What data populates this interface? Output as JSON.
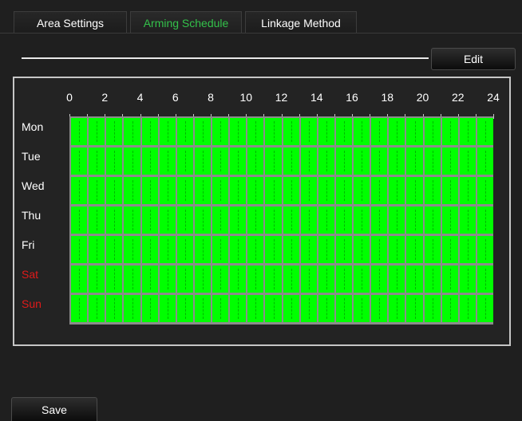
{
  "tabs": [
    {
      "label": "Area Settings",
      "active": false
    },
    {
      "label": "Arming Schedule",
      "active": true
    },
    {
      "label": "Linkage Method",
      "active": false
    }
  ],
  "toolbar": {
    "edit_label": "Edit"
  },
  "schedule": {
    "hours": [
      "0",
      "2",
      "4",
      "6",
      "8",
      "10",
      "12",
      "14",
      "16",
      "18",
      "20",
      "22",
      "24"
    ],
    "days": [
      {
        "label": "Mon",
        "weekend": false,
        "armed_all_day": true
      },
      {
        "label": "Tue",
        "weekend": false,
        "armed_all_day": true
      },
      {
        "label": "Wed",
        "weekend": false,
        "armed_all_day": true
      },
      {
        "label": "Thu",
        "weekend": false,
        "armed_all_day": true
      },
      {
        "label": "Fri",
        "weekend": false,
        "armed_all_day": true
      },
      {
        "label": "Sat",
        "weekend": true,
        "armed_all_day": true
      },
      {
        "label": "Sun",
        "weekend": true,
        "armed_all_day": true
      }
    ],
    "armed_color": "#00ff00",
    "weekend_label_color": "#e01a1a",
    "active_tab_color": "#33c24a"
  },
  "footer": {
    "save_label": "Save"
  }
}
